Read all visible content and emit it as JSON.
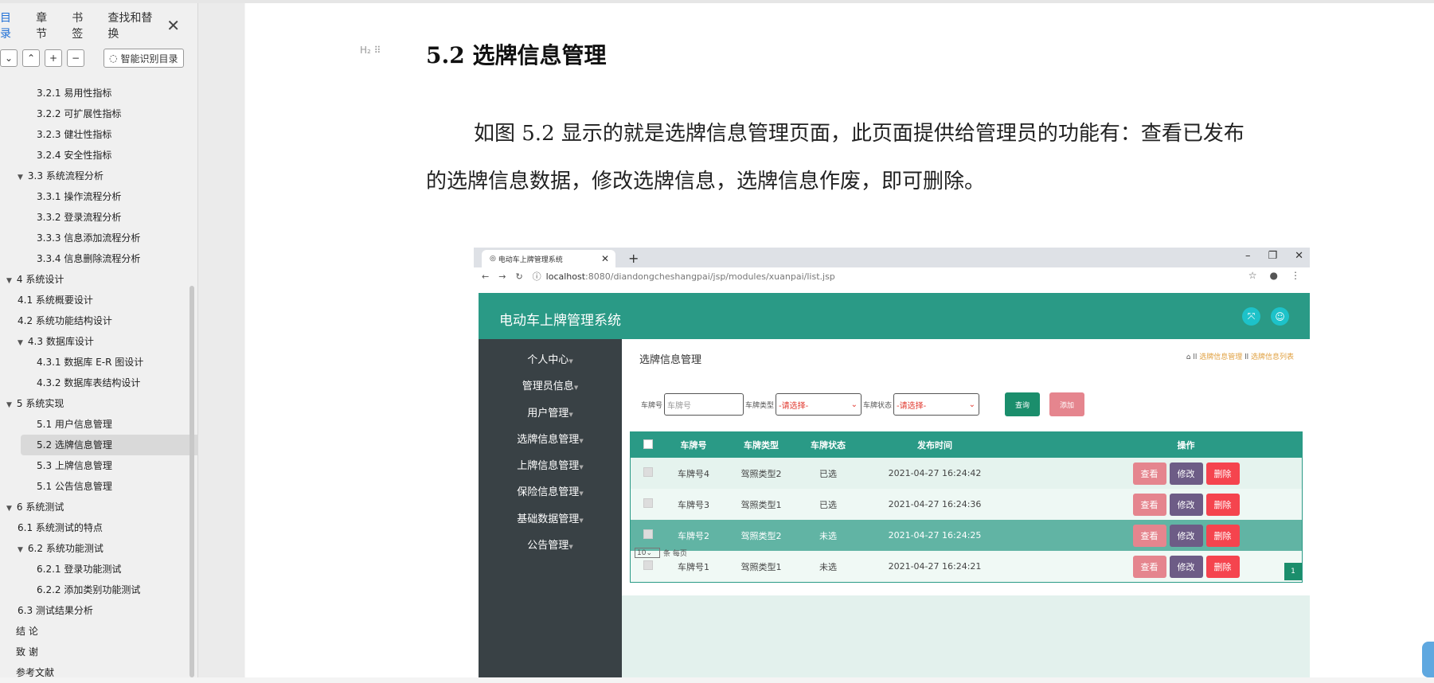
{
  "left_panel": {
    "tabs": [
      "目录",
      "章节",
      "书签",
      "查找和替换"
    ],
    "close_symbol": "✕",
    "ai_toc_button": "智能识别目录",
    "toc": [
      {
        "label": "3.2.1  易用性指标",
        "level": 3
      },
      {
        "label": "3.2.2  可扩展性指标",
        "level": 3
      },
      {
        "label": "3.2.3  健壮性指标",
        "level": 3
      },
      {
        "label": "3.2.4  安全性指标",
        "level": 3
      },
      {
        "label": "3.3  系统流程分析",
        "level": 2,
        "expanded": true
      },
      {
        "label": "3.3.1  操作流程分析",
        "level": 3
      },
      {
        "label": "3.3.2  登录流程分析",
        "level": 3
      },
      {
        "label": "3.3.3  信息添加流程分析",
        "level": 3
      },
      {
        "label": "3.3.4  信息删除流程分析",
        "level": 3
      },
      {
        "label": "4  系统设计",
        "level": 1,
        "expanded": true
      },
      {
        "label": "4.1  系统概要设计",
        "level": 2
      },
      {
        "label": "4.2  系统功能结构设计",
        "level": 2
      },
      {
        "label": "4.3  数据库设计",
        "level": 2,
        "expanded": true
      },
      {
        "label": "4.3.1  数据库 E-R 图设计",
        "level": 3
      },
      {
        "label": "4.3.2  数据库表结构设计",
        "level": 3
      },
      {
        "label": "5  系统实现",
        "level": 1,
        "expanded": true
      },
      {
        "label": "5.1 用户信息管理",
        "level": 3
      },
      {
        "label": "5.2  选牌信息管理",
        "level": 3,
        "selected": true
      },
      {
        "label": "5.3  上牌信息管理",
        "level": 3
      },
      {
        "label": "5.1 公告信息管理",
        "level": 3
      },
      {
        "label": "6  系统测试",
        "level": 1,
        "expanded": true
      },
      {
        "label": "6.1  系统测试的特点",
        "level": 2
      },
      {
        "label": "6.2  系统功能测试",
        "level": 2,
        "expanded": true
      },
      {
        "label": "6.2.1  登录功能测试",
        "level": 3
      },
      {
        "label": "6.2.2  添加类别功能测试",
        "level": 3
      },
      {
        "label": "6.3  测试结果分析",
        "level": 2
      },
      {
        "label": "结    论",
        "level": 1
      },
      {
        "label": "致    谢",
        "level": 1
      },
      {
        "label": "参考文献",
        "level": 1
      }
    ]
  },
  "document": {
    "heading_handle": "H₂ ⠿",
    "heading": "5.2  选牌信息管理",
    "paragraph": "如图 5.2 显示的就是选牌信息管理页面，此页面提供给管理员的功能有：查看已发布的选牌信息数据，修改选牌信息，选牌信息作废，即可删除。"
  },
  "screenshot": {
    "browser": {
      "tab_title": "电动车上牌管理系统",
      "tab_close": "✕",
      "new_tab": "+",
      "url_host": "localhost",
      "url_rest": ":8080/diandongcheshangpai/jsp/modules/xuanpai/list.jsp"
    },
    "app": {
      "title": "电动车上牌管理系统",
      "sidebar": [
        "个人中心",
        "管理员信息",
        "用户管理",
        "选牌信息管理",
        "上牌信息管理",
        "保险信息管理",
        "基础数据管理",
        "公告管理"
      ],
      "page_title": "选牌信息管理",
      "breadcrumb": [
        "选牌信息管理",
        "选牌信息列表"
      ],
      "filters": {
        "plate_label": "车牌号",
        "plate_placeholder": "车牌号",
        "type_label": "车牌类型",
        "type_value": "-请选择-",
        "status_label": "车牌状态",
        "status_value": "-请选择-",
        "query_button": "查询",
        "add_button": "添加"
      },
      "table": {
        "headers": [
          "车牌号",
          "车牌类型",
          "车牌状态",
          "发布时间",
          "操作"
        ],
        "rows": [
          {
            "plate": "车牌号4",
            "type": "驾照类型2",
            "status": "已选",
            "time": "2021-04-27 16:24:42"
          },
          {
            "plate": "车牌号3",
            "type": "驾照类型1",
            "status": "已选",
            "time": "2021-04-27 16:24:36"
          },
          {
            "plate": "车牌号2",
            "type": "驾照类型2",
            "status": "未选",
            "time": "2021-04-27 16:24:25"
          },
          {
            "plate": "车牌号1",
            "type": "驾照类型1",
            "status": "未选",
            "time": "2021-04-27 16:24:21"
          }
        ],
        "actions": {
          "view": "查看",
          "edit": "修改",
          "delete": "删除"
        }
      },
      "pager": {
        "page_size": "10",
        "per_page_text": "条 每页",
        "current_page": "1"
      }
    }
  },
  "colors": {
    "accent": "#2a9a86",
    "sidebar": "#394145",
    "delete": "#f5444e",
    "edit": "#6d5c86",
    "view": "#e5858e"
  }
}
